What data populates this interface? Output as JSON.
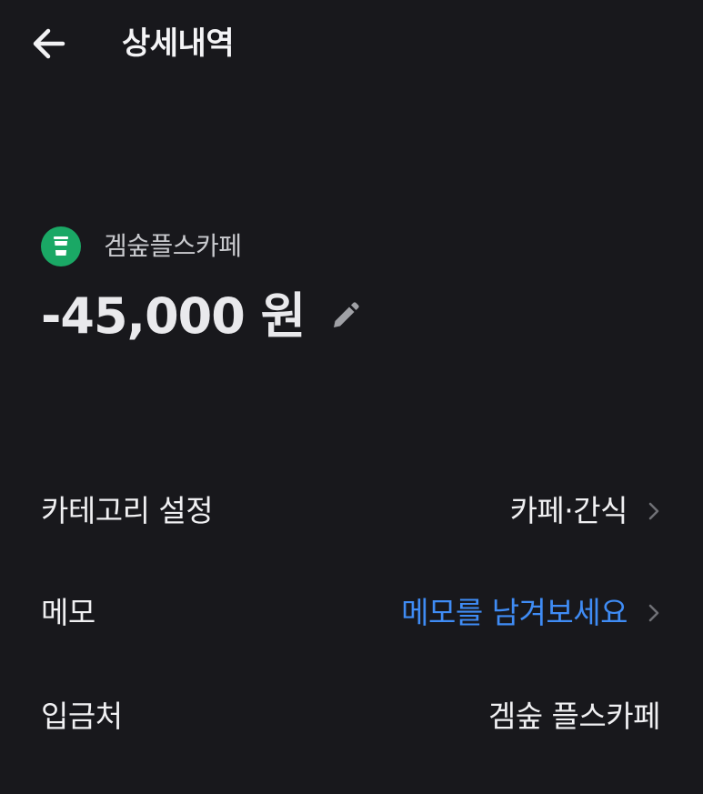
{
  "header": {
    "title": "상세내역",
    "back_icon": "arrow-left-icon"
  },
  "transaction": {
    "merchant_name": "겜숲플스카페",
    "merchant_icon": "coffee-cup-icon",
    "merchant_icon_color": "#1aa865",
    "amount": "-45,000 원",
    "edit_icon": "pencil-icon"
  },
  "details": {
    "category": {
      "label": "카테고리 설정",
      "value": "카페·간식"
    },
    "memo": {
      "label": "메모",
      "placeholder": "메모를 남겨보세요",
      "placeholder_color": "#3f8cf5"
    },
    "depositor": {
      "label": "입금처",
      "value": "겜숲 플스카페"
    }
  },
  "colors": {
    "background": "#18181c",
    "text": "#f0f0f2",
    "muted_text": "#c9cace"
  }
}
